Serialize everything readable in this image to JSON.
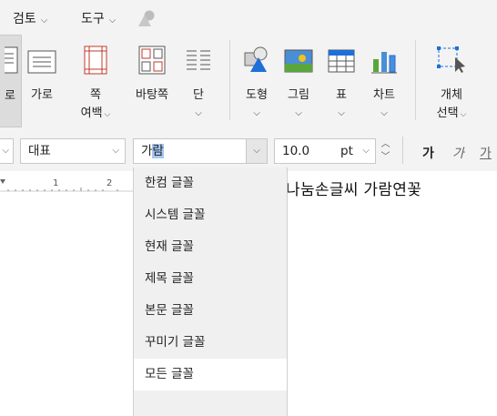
{
  "menubar": {
    "items": [
      {
        "label": "검토"
      },
      {
        "label": "도구"
      }
    ]
  },
  "ribbon": {
    "buttons": [
      {
        "label": "로"
      },
      {
        "label": "가로"
      },
      {
        "label": "쪽",
        "label2": "여백"
      },
      {
        "label": "바탕쪽"
      },
      {
        "label": "단"
      },
      {
        "label": "도형"
      },
      {
        "label": "그림"
      },
      {
        "label": "표"
      },
      {
        "label": "차트"
      },
      {
        "label": "개체",
        "label2": "선택"
      }
    ]
  },
  "format": {
    "style_value": "대표",
    "font_value_a": "가",
    "font_value_b": "람",
    "size_value": "10.0",
    "size_unit": "pt",
    "bold_glyph": "가",
    "italic_glyph": "가",
    "underline_glyph": "가"
  },
  "ruler": {
    "ticks": [
      "1",
      "2"
    ]
  },
  "font_dropdown": {
    "items": [
      {
        "label": "한컴 글꼴"
      },
      {
        "label": "시스템 글꼴"
      },
      {
        "label": "현재 글꼴"
      },
      {
        "label": "제목 글꼴"
      },
      {
        "label": "본문 글꼴"
      },
      {
        "label": "꾸미기 글꼴"
      },
      {
        "label": "모든 글꼴"
      }
    ],
    "highlighted_index": 6
  },
  "preview_text": "나눔손글씨 가람연꽃",
  "colors": {
    "accent_blue": "#1e6fd9",
    "selection": "#a6c8f2",
    "chart_blue": "#4a8fd6",
    "picture_green": "#5aa63c",
    "picture_yellow": "#f1c21b"
  }
}
